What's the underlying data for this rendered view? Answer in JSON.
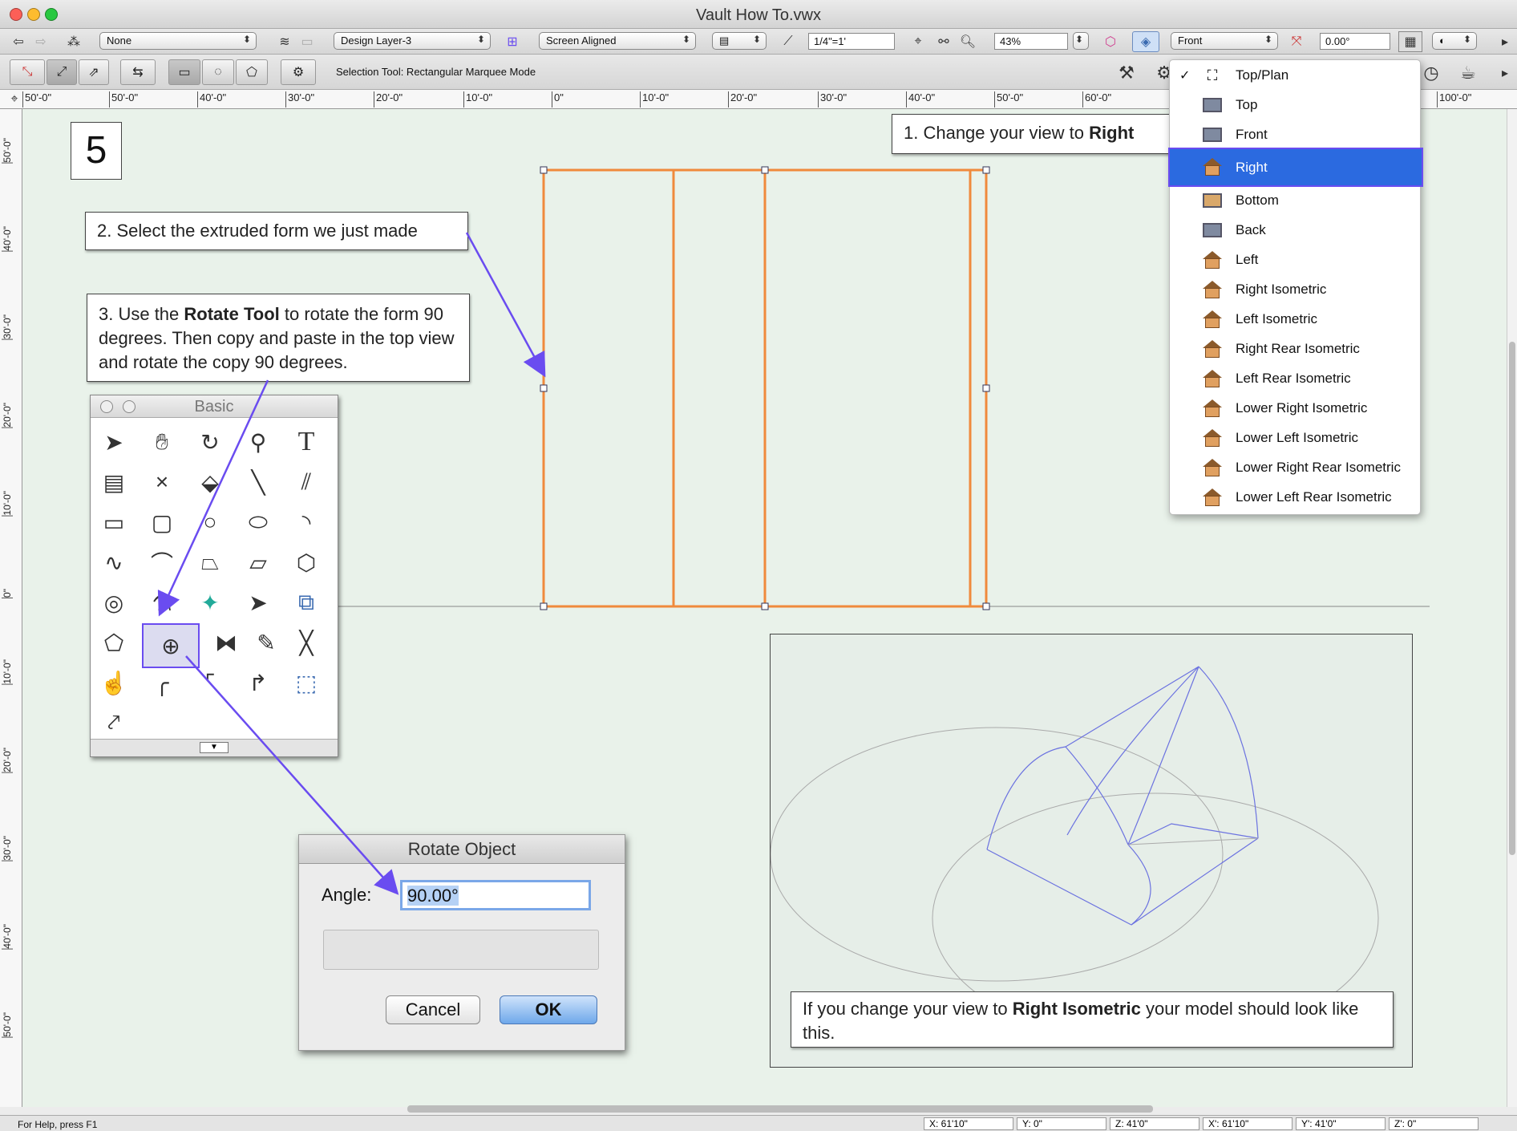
{
  "window": {
    "title": "Vault How To.vwx"
  },
  "toolbar1": {
    "class_popup": "None",
    "layer_popup": "Design Layer-3",
    "plane_popup": "Screen Aligned",
    "scale_field": "1/4\"=1'",
    "zoom_field": "43%",
    "view_popup": "Front",
    "angle_field": "0.00°"
  },
  "toolbar2": {
    "mode_label": "Selection Tool: Rectangular Marquee Mode"
  },
  "ruler": {
    "h_ticks": [
      "50'-0\"",
      "50'-0\"",
      "40'-0\"",
      "30'-0\"",
      "20'-0\"",
      "10'-0\"",
      "0\"",
      "10'-0\"",
      "20'-0\"",
      "30'-0\"",
      "40'-0\"",
      "50'-0\"",
      "60'-0\"",
      "100'-0\""
    ],
    "v_ticks": [
      "50'-0\"",
      "40'-0\"",
      "30'-0\"",
      "20'-0\"",
      "10'-0\"",
      "0\"",
      "10'-0\"",
      "20'-0\"",
      "30'-0\"",
      "40'-0\"",
      "50'-0\""
    ]
  },
  "step_number": "5",
  "notes": {
    "n1_prefix": "1. Change your view to ",
    "n1_bold": "Right",
    "n2": "2. Select the extruded form we just made",
    "n3_prefix": "3. Use the ",
    "n3_bold": "Rotate Tool",
    "n3_suffix": " to rotate the form 90 degrees. Then copy and paste in the top view and rotate the copy  90 degrees.",
    "n4_prefix": "If you change your view to ",
    "n4_bold": "Right Isometric",
    "n4_suffix": " your model should look like this."
  },
  "palette": {
    "title": "Basic"
  },
  "dialog": {
    "title": "Rotate Object",
    "angle_label": "Angle:",
    "angle_value": "90.00°",
    "cancel_label": "Cancel",
    "ok_label": "OK"
  },
  "view_menu": {
    "items": [
      {
        "label": "Top/Plan",
        "checked": "✓"
      },
      {
        "label": "Top"
      },
      {
        "label": "Front"
      },
      {
        "label": "Right"
      },
      {
        "label": "Bottom"
      },
      {
        "label": "Back"
      },
      {
        "label": "Left"
      },
      {
        "label": "Right Isometric"
      },
      {
        "label": "Left Isometric"
      },
      {
        "label": "Right Rear Isometric"
      },
      {
        "label": "Left Rear Isometric"
      },
      {
        "label": "Lower Right Isometric"
      },
      {
        "label": "Lower Left Isometric"
      },
      {
        "label": "Lower Right Rear Isometric"
      },
      {
        "label": "Lower Left Rear Isometric"
      }
    ]
  },
  "status": {
    "help": "For Help, press F1",
    "x": "X:  61'10\"",
    "y": "Y:  0\"",
    "z": "Z:  41'0\"",
    "xp": "X':  61'10\"",
    "yp": "Y':  41'0\"",
    "zp": "Z':  0\""
  },
  "colors": {
    "accent": "#6a4cf0",
    "selection": "#2b6ae0",
    "extrusion": "#f08a3c",
    "canvas": "#e9f2ea"
  }
}
